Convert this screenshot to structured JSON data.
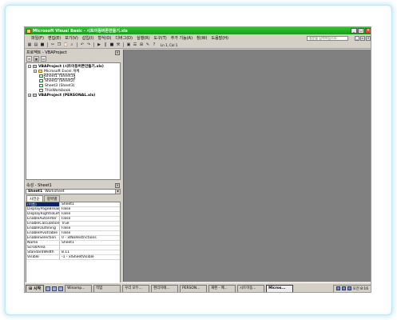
{
  "window": {
    "title": "Microsoft Visual Basic - 시트이동버튼만들기.xls"
  },
  "menu": {
    "items": [
      "파일(F)",
      "편집(E)",
      "보기(V)",
      "삽입(I)",
      "형식(O)",
      "디버그(D)",
      "실행(R)",
      "도구(T)",
      "추가 기능(A)",
      "창(W)",
      "도움말(H)"
    ],
    "help_placeholder": "질문을 입력하십시오."
  },
  "toolbar": {
    "position": "Ln 1, Col 1"
  },
  "project": {
    "title": "프로젝트 - VBAProject",
    "tree": [
      {
        "label": "VBAProject (시트이동버튼만들기.xls)",
        "level": 0,
        "bold": true,
        "icon": "project"
      },
      {
        "label": "Microsoft Excel 개체",
        "level": 1,
        "bold": false,
        "icon": "folder"
      },
      {
        "label": "Sheet1 (Sheet1)",
        "level": 2,
        "bold": false,
        "icon": "sheet",
        "selected": true
      },
      {
        "label": "Sheet2 (Sheet2)",
        "level": 2,
        "bold": false,
        "icon": "sheet"
      },
      {
        "label": "Sheet3 (Sheet3)",
        "level": 2,
        "bold": false,
        "icon": "sheet"
      },
      {
        "label": "ThisWorkbook",
        "level": 2,
        "bold": false,
        "icon": "sheet"
      },
      {
        "label": "VBAProject (PERSONAL.xls)",
        "level": 0,
        "bold": true,
        "icon": "project"
      }
    ]
  },
  "properties": {
    "title": "속성 - Sheet1",
    "object_name": "Sheet1",
    "object_type": "Worksheet",
    "tabs": [
      "사전순",
      "항목별"
    ],
    "rows": [
      {
        "name": "(이름)",
        "value": "Sheet1",
        "selected": true
      },
      {
        "name": "DisplayPageBreaks",
        "value": "False"
      },
      {
        "name": "DisplayRightToLeft",
        "value": "False"
      },
      {
        "name": "EnableAutoFilter",
        "value": "False"
      },
      {
        "name": "EnableCalculation",
        "value": "True"
      },
      {
        "name": "EnableOutlining",
        "value": "False"
      },
      {
        "name": "EnablePivotTable",
        "value": "False"
      },
      {
        "name": "EnableSelection",
        "value": "0 - xlNoRestrictions"
      },
      {
        "name": "Name",
        "value": "Sheet1"
      },
      {
        "name": "ScrollArea",
        "value": ""
      },
      {
        "name": "StandardWidth",
        "value": "8.11"
      },
      {
        "name": "Visible",
        "value": "-1 - xlSheetVisible"
      }
    ]
  },
  "taskbar": {
    "start_label": "시작",
    "buttons": [
      "Winamp...",
      "작업",
      "우리 모두...",
      "편리지에...",
      "PERSON...",
      "재편 - 메...",
      "시트이동...",
      "Micros..."
    ],
    "active_index": 7,
    "clock": "오전 8:16"
  },
  "colors": {
    "title_bar": "#1f9a1f",
    "workspace": "#808080",
    "selection": "#0a246a"
  }
}
